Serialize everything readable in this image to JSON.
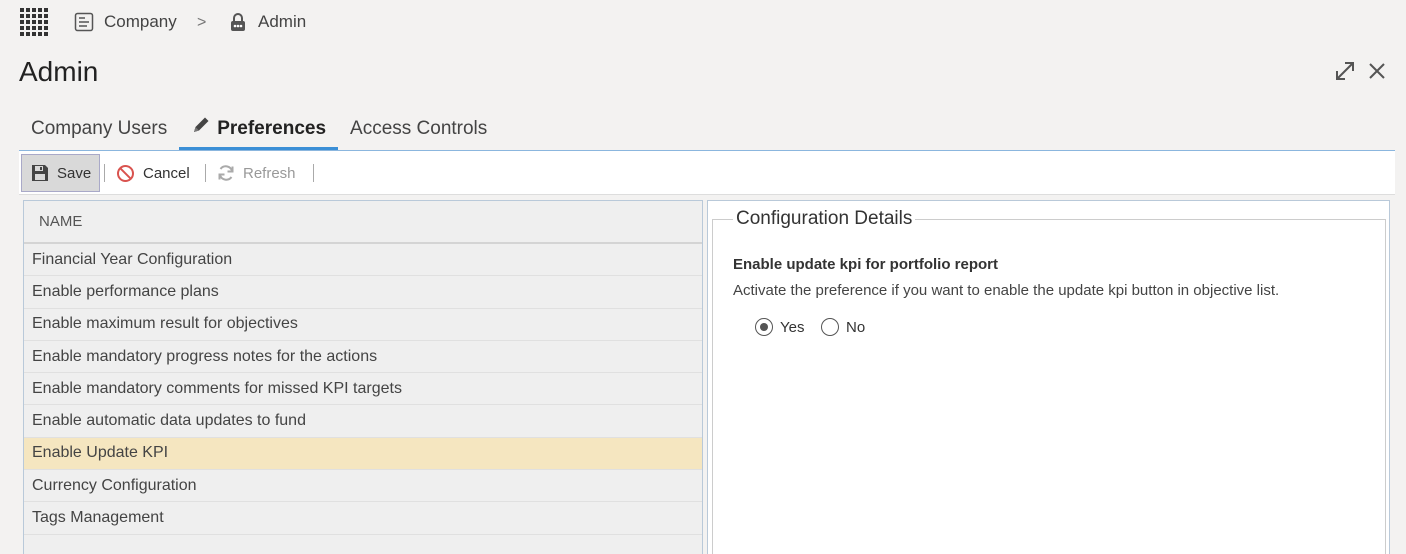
{
  "breadcrumb": {
    "company_label": "Company",
    "separator": ">",
    "admin_label": "Admin"
  },
  "page": {
    "title": "Admin"
  },
  "tabs": [
    {
      "label": "Company Users",
      "active": false
    },
    {
      "label": "Preferences",
      "active": true
    },
    {
      "label": "Access Controls",
      "active": false
    }
  ],
  "toolbar": {
    "save_label": "Save",
    "cancel_label": "Cancel",
    "refresh_label": "Refresh"
  },
  "list": {
    "header": "NAME",
    "items": [
      "Financial Year Configuration",
      "Enable performance plans",
      "Enable maximum result for objectives",
      "Enable mandatory progress notes for the actions",
      "Enable mandatory comments for missed KPI targets",
      "Enable automatic data updates to fund",
      "Enable Update KPI",
      "Currency Configuration",
      "Tags Management"
    ],
    "selected_index": 6
  },
  "details": {
    "legend": "Configuration Details",
    "pref_title": "Enable update kpi for portfolio report",
    "pref_description": "Activate the preference if you want to enable the update kpi button in objective list.",
    "options": {
      "yes": "Yes",
      "no": "No"
    },
    "selected": "yes"
  },
  "colors": {
    "accent": "#3b8fd6",
    "selected_row": "#f5e6c0",
    "cancel_icon": "#d9534f"
  }
}
